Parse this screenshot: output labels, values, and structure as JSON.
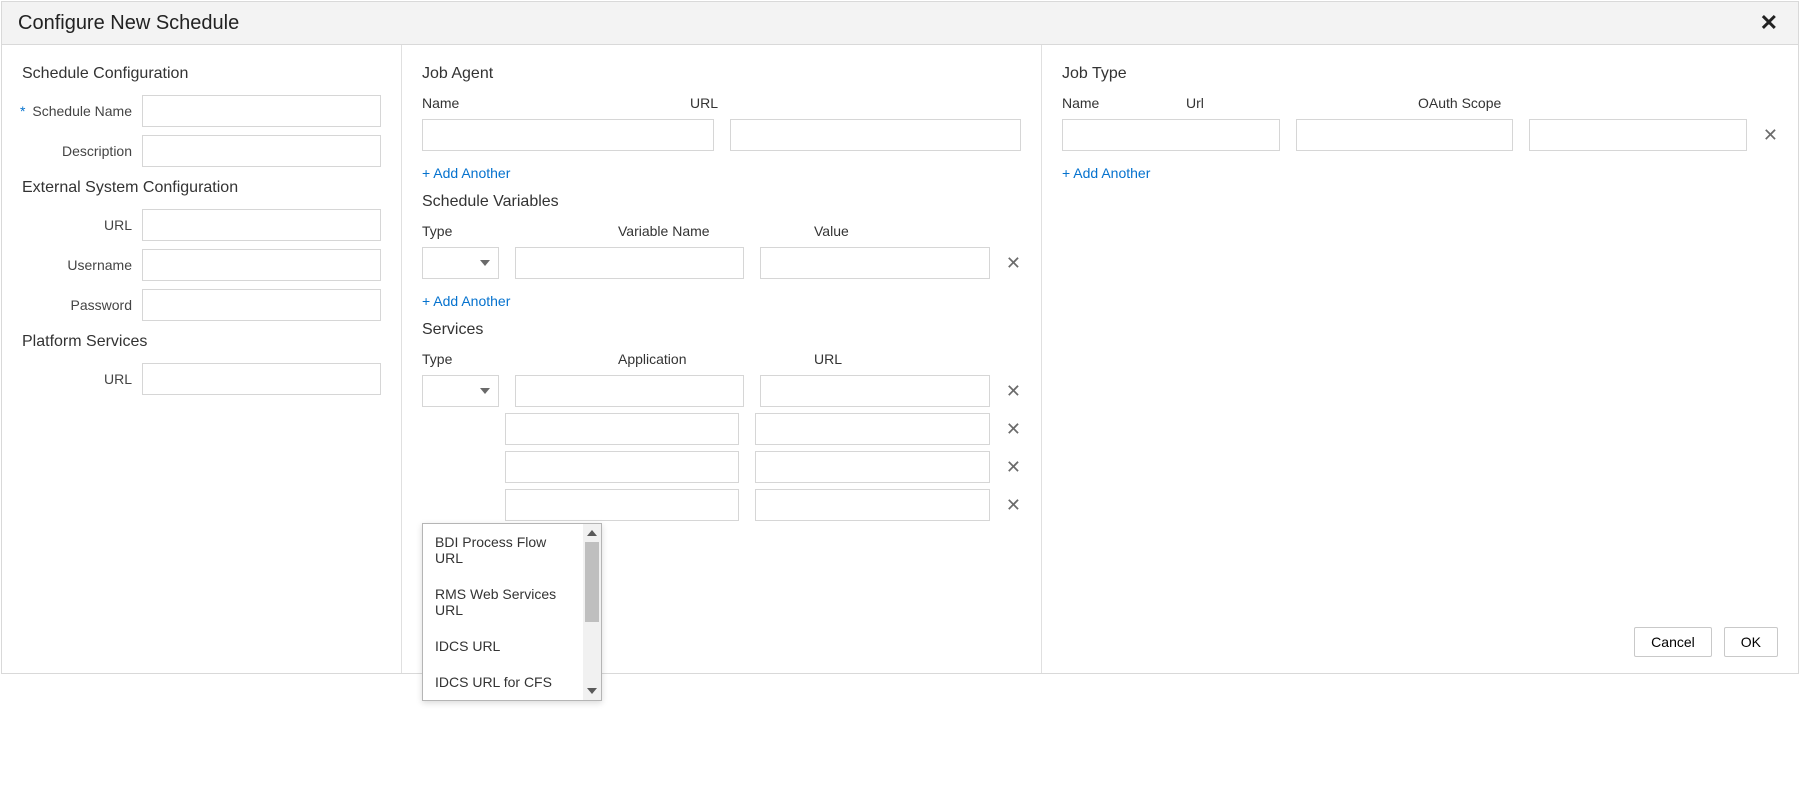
{
  "dialog": {
    "title": "Configure New Schedule",
    "close_glyph": "✕"
  },
  "schedule_config": {
    "section": "Schedule Configuration",
    "name_label": "Schedule Name",
    "name_value": "",
    "desc_label": "Description",
    "desc_value": ""
  },
  "ext_sys": {
    "section": "External System Configuration",
    "url_label": "URL",
    "url_value": "",
    "user_label": "Username",
    "user_value": "",
    "pass_label": "Password",
    "pass_value": ""
  },
  "platform": {
    "section": "Platform Services",
    "url_label": "URL",
    "url_value": ""
  },
  "job_agent": {
    "section": "Job Agent",
    "h_name": "Name",
    "h_url": "URL",
    "rows": [
      {
        "name": "",
        "url": ""
      }
    ],
    "add": "+ Add Another"
  },
  "sched_vars": {
    "section": "Schedule Variables",
    "h_type": "Type",
    "h_var": "Variable Name",
    "h_val": "Value",
    "rows": [
      {
        "type": "",
        "var": "",
        "val": ""
      }
    ],
    "add": "+ Add Another"
  },
  "services": {
    "section": "Services",
    "h_type": "Type",
    "h_app": "Application",
    "h_url": "URL",
    "rows": [
      {
        "type": "",
        "app": "",
        "url": ""
      },
      {
        "type": "",
        "app": "",
        "url": ""
      },
      {
        "type": "",
        "app": "",
        "url": ""
      },
      {
        "type": "",
        "app": "",
        "url": ""
      }
    ],
    "type_options_visible": [
      "BDI Process Flow URL",
      "RMS Web Services URL",
      "IDCS URL",
      "IDCS URL for CFS"
    ]
  },
  "job_type": {
    "section": "Job Type",
    "h_name": "Name",
    "h_url": "Url",
    "h_scope": "OAuth Scope",
    "rows": [
      {
        "name": "",
        "url": "",
        "scope": ""
      }
    ],
    "add": "+ Add Another"
  },
  "footer": {
    "cancel": "Cancel",
    "ok": "OK"
  },
  "icons": {
    "row_delete_glyph": "✕"
  }
}
